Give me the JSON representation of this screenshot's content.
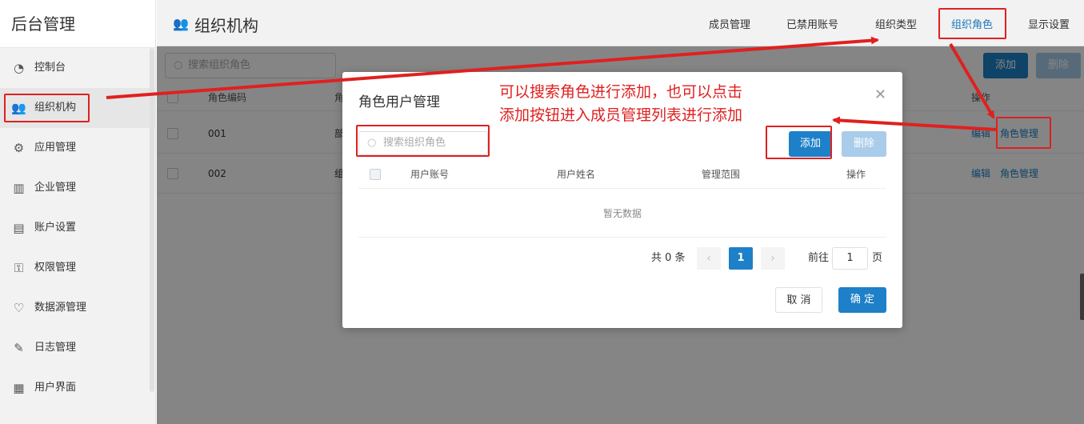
{
  "sidebar": {
    "title": "后台管理",
    "items": [
      {
        "label": "控制台",
        "icon": "dashboard-icon",
        "glyph": "◔"
      },
      {
        "label": "组织机构",
        "icon": "people-icon",
        "glyph": "👥"
      },
      {
        "label": "应用管理",
        "icon": "user-gear-icon",
        "glyph": "⚙"
      },
      {
        "label": "企业管理",
        "icon": "building-icon",
        "glyph": "▥"
      },
      {
        "label": "账户设置",
        "icon": "account-card-icon",
        "glyph": "▤"
      },
      {
        "label": "权限管理",
        "icon": "permission-icon",
        "glyph": "⚿"
      },
      {
        "label": "数据源管理",
        "icon": "heart-handshake-icon",
        "glyph": "♡"
      },
      {
        "label": "日志管理",
        "icon": "pen-icon",
        "glyph": "✎"
      },
      {
        "label": "用户界面",
        "icon": "layout-icon",
        "glyph": "▦"
      }
    ]
  },
  "header": {
    "title": "组织机构",
    "tabs": [
      "成员管理",
      "已禁用账号",
      "组织类型",
      "组织角色",
      "显示设置"
    ],
    "active_tab": "组织角色"
  },
  "toolbar": {
    "search_placeholder": "搜索组织角色",
    "add_label": "添加",
    "delete_label": "删除"
  },
  "table": {
    "headers": [
      "角色编码",
      "角",
      "操作"
    ],
    "rows": [
      {
        "code": "001",
        "name": "部",
        "actions": [
          "编辑",
          "角色管理"
        ]
      },
      {
        "code": "002",
        "name": "组",
        "actions": [
          "编辑",
          "角色管理"
        ]
      }
    ]
  },
  "modal": {
    "title": "角色用户管理",
    "search_placeholder": "搜索组织角色",
    "add_label": "添加",
    "delete_label": "删除",
    "columns": [
      "用户账号",
      "用户姓名",
      "管理范围",
      "操作"
    ],
    "empty_text": "暂无数据",
    "pagination": {
      "total_text": "共 0 条",
      "current_page": "1",
      "goto_prefix": "前往",
      "goto_value": "1",
      "goto_suffix": "页"
    },
    "cancel_label": "取 消",
    "confirm_label": "确 定"
  },
  "annotation": {
    "line1": "可以搜索角色进行添加，也可以点击",
    "line2": "添加按钮进入成员管理列表进行添加"
  },
  "colors": {
    "accent": "#1e80c8",
    "annotation_red": "#e02020"
  }
}
